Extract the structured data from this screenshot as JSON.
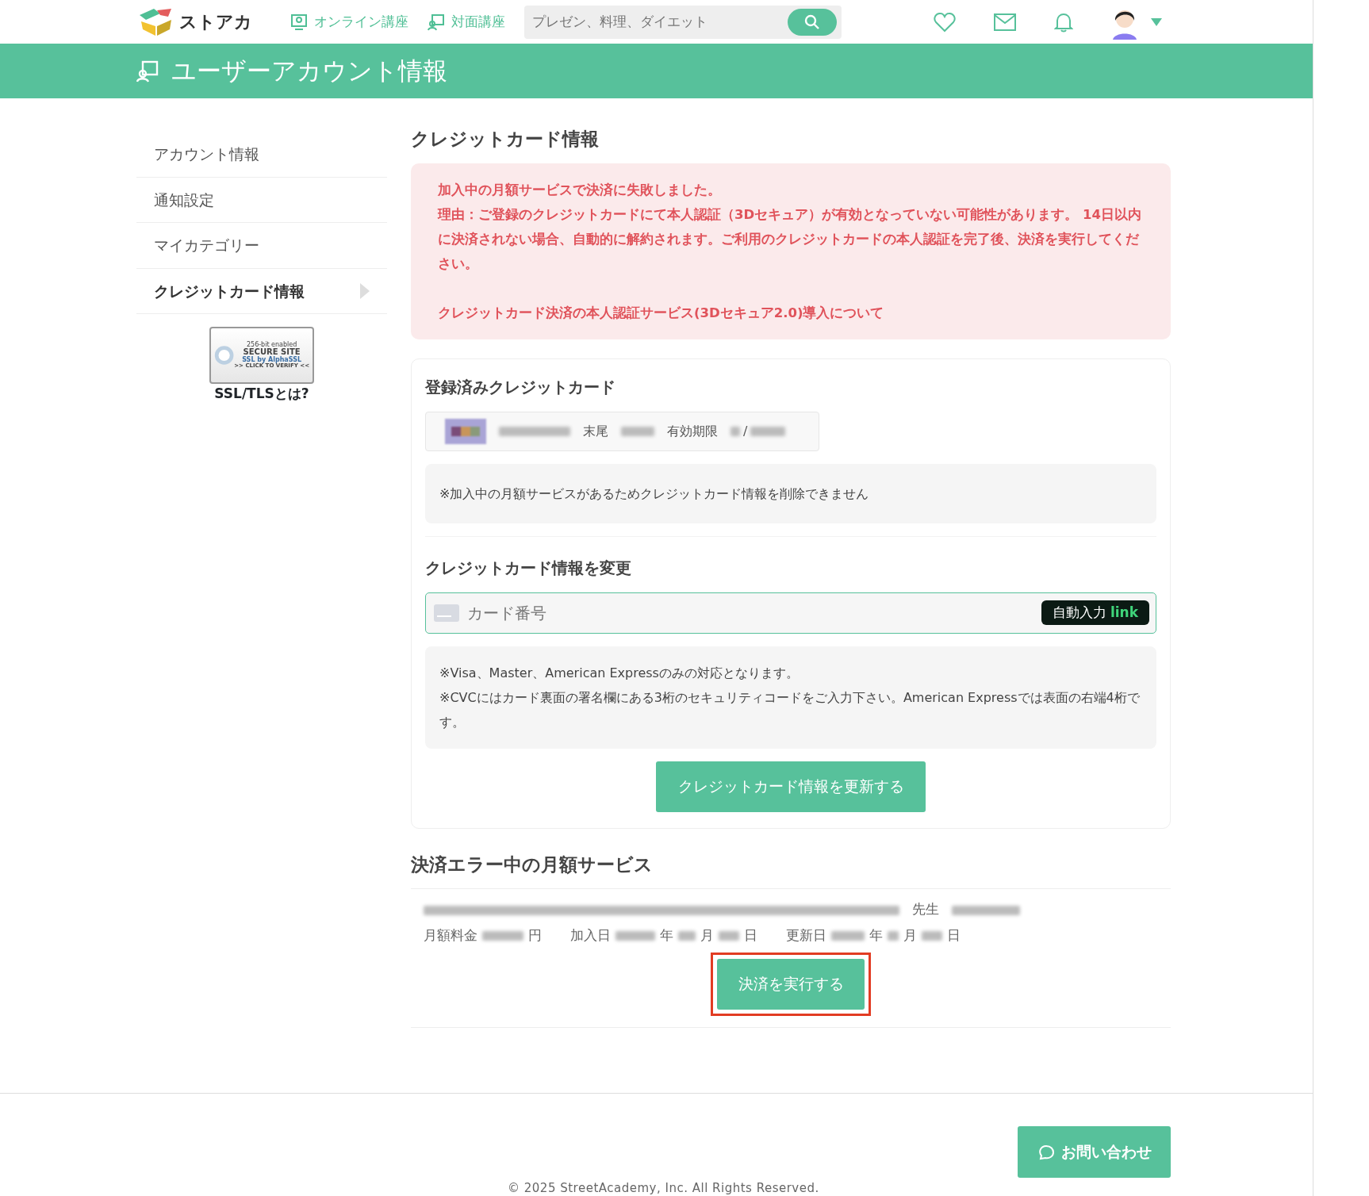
{
  "header": {
    "logo_text": "ストアカ",
    "nav": [
      {
        "label": "オンライン講座",
        "kind": "online"
      },
      {
        "label": "対面講座",
        "kind": "offline"
      }
    ],
    "search": {
      "placeholder": "プレゼン、料理、ダイエット"
    }
  },
  "page_title": "ユーザーアカウント情報",
  "sidebar": {
    "items": [
      {
        "label": "アカウント情報",
        "selected": false
      },
      {
        "label": "通知設定",
        "selected": false
      },
      {
        "label": "マイカテゴリー",
        "selected": false
      },
      {
        "label": "クレジットカード情報",
        "selected": true
      }
    ],
    "ssl_badge": {
      "line_1": "256-bit enabled",
      "line_2": "SECURE SITE",
      "line_3": "SSL by AlphaSSL",
      "line_4": ">> CLICK TO VERIFY <<"
    },
    "ssl_link": "SSL/TLSとは?"
  },
  "main": {
    "heading": "クレジットカード情報",
    "alert": {
      "title": "加入中の月額サービスで決済に失敗しました。",
      "message": "理由：ご登録のクレジットカードにて本人認証（3Dセキュア）が有効となっていない可能性があります。 14日以内に決済されない場合、自動的に解約されます。ご利用のクレジットカードの本人認証を完了後、決済を実行してください。",
      "link": "クレジットカード決済の本人認証サービス(3Dセキュア2.0)導入について"
    },
    "registered": {
      "heading": "登録済みクレジットカード",
      "last_digits_label": "末尾",
      "expiry_label": "有効期限",
      "expiry_separator": "/",
      "notice": "※加入中の月額サービスがあるためクレジットカード情報を削除できません"
    },
    "change": {
      "heading": "クレジットカード情報を変更",
      "card_number": {
        "placeholder": "カード番号"
      },
      "autofill": {
        "label": "自動入力",
        "brand": "link"
      },
      "notes": [
        "※Visa、Master、American Expressのみの対応となります。",
        "※CVCにはカード裏面の署名欄にある3桁のセキュリティコードをご入力下さい。American Expressでは表面の右端4桁です。"
      ],
      "submit": "クレジットカード情報を更新する"
    },
    "services": {
      "heading": "決済エラー中の月額サービス",
      "items": [
        {
          "teacher_suffix": "先生",
          "fee_label": "月額料金",
          "yen": "円",
          "joined": {
            "label": "加入日",
            "year": "年",
            "month": "月",
            "day": "日"
          },
          "renewal": {
            "label": "更新日",
            "year": "年",
            "month": "月",
            "day": "日"
          }
        }
      ],
      "pay_button": {
        "label": "決済を実行する",
        "highlighted": true
      }
    }
  },
  "footer": {
    "contact": "お問い合わせ",
    "copyright": "© 2025 StreetAcademy, Inc. All Rights Reserved."
  }
}
